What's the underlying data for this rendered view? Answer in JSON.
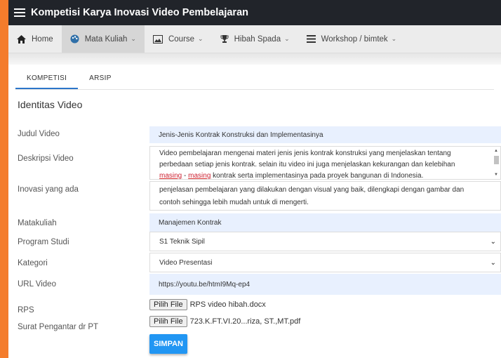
{
  "app": {
    "title": "Kompetisi Karya Inovasi Video Pembelajaran"
  },
  "nav": {
    "items": [
      {
        "label": "Home",
        "icon": "home-icon"
      },
      {
        "label": "Mata Kuliah",
        "icon": "palette-icon"
      },
      {
        "label": "Course",
        "icon": "image-icon"
      },
      {
        "label": "Hibah Spada",
        "icon": "trophy-icon"
      },
      {
        "label": "Workshop / bimtek",
        "icon": "list-icon"
      }
    ]
  },
  "tabs": [
    "KOMPETISI",
    "ARSIP"
  ],
  "section_title": "Identitas Video",
  "form": {
    "judul_label": "Judul Video",
    "judul_value": "Jenis-Jenis Kontrak Konstruksi dan Implementasinya",
    "deskripsi_label": "Deskripsi Video",
    "deskripsi_line1": "Video pembelajaran mengenai materi jenis jenis kontrak konstruksi yang menjelaskan tentang",
    "deskripsi_line2": "perbedaan setiap jenis kontrak. selain itu video ini juga menjelaskan kekurangan dan kelebihan",
    "deskripsi_line3_a": "masing",
    "deskripsi_line3_sep": " - ",
    "deskripsi_line3_b": "masing",
    "deskripsi_line3_c": " kontrak serta implementasinya pada proyek bangunan di Indonesia.",
    "inovasi_label": "Inovasi yang ada",
    "inovasi_line1": "penjelasan pembelajaran yang dilakukan dengan visual yang baik, dilengkapi dengan gambar dan",
    "inovasi_line2": "contoh sehingga lebih mudah untuk di mengerti.",
    "matakuliah_label": "Matakuliah",
    "matakuliah_value": "Manajemen Kontrak",
    "prodi_label": "Program Studi",
    "prodi_value": "S1 Teknik Sipil",
    "kategori_label": "Kategori",
    "kategori_value": "Video Presentasi",
    "url_label": "URL Video",
    "url_value": "https://youtu.be/htmI9Mq-ep4",
    "rps_label": "RPS",
    "rps_button": "Pilih File",
    "rps_file": "RPS video hibah.docx",
    "surat_label": "Surat Pengantar dr PT",
    "surat_button": "Pilih File",
    "surat_file": "723.K.FT.VI.20...riza, ST.,MT.pdf",
    "save_label": "SIMPAN"
  },
  "colors": {
    "accent": "#2196f3",
    "titlebar": "#21242a",
    "frame": "#f47c2c",
    "field_bg": "#e8f0fe"
  }
}
